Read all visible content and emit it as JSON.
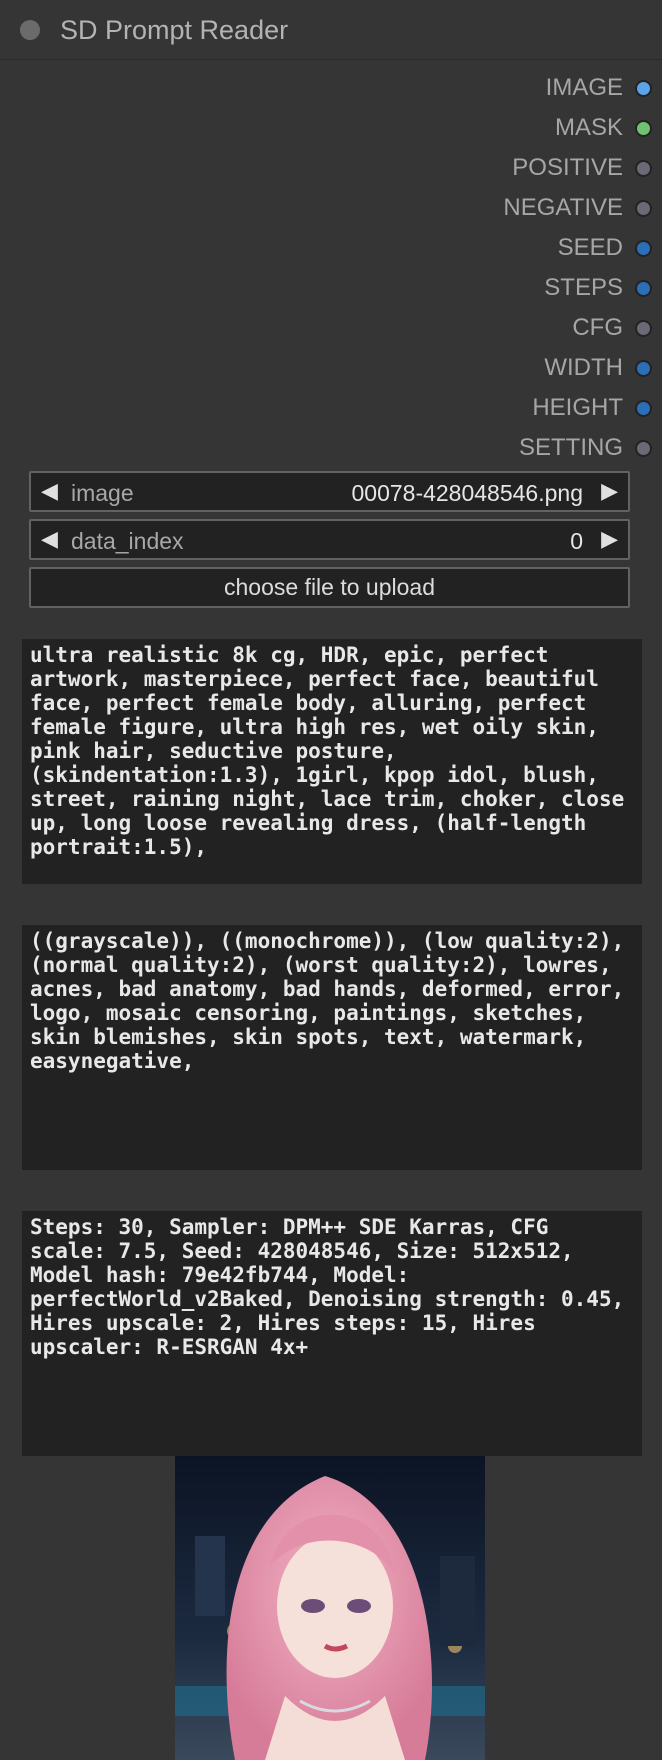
{
  "node": {
    "title": "SD Prompt Reader"
  },
  "outputs": [
    {
      "label": "IMAGE",
      "color": "#5aa3e8"
    },
    {
      "label": "MASK",
      "color": "#6fc26f"
    },
    {
      "label": "POSITIVE",
      "color": "#6a6a76"
    },
    {
      "label": "NEGATIVE",
      "color": "#6a6a76"
    },
    {
      "label": "SEED",
      "color": "#2a6fb8"
    },
    {
      "label": "STEPS",
      "color": "#2a6fb8"
    },
    {
      "label": "CFG",
      "color": "#6a6a76"
    },
    {
      "label": "WIDTH",
      "color": "#2a6fb8"
    },
    {
      "label": "HEIGHT",
      "color": "#2a6fb8"
    },
    {
      "label": "SETTING",
      "color": "#6a6a76"
    }
  ],
  "widgets": {
    "image": {
      "label": "image",
      "value": "00078-428048546.png"
    },
    "data_index": {
      "label": "data_index",
      "value": "0"
    },
    "upload": {
      "label": "choose file to upload"
    }
  },
  "texts": {
    "positive": "ultra realistic 8k cg, HDR, epic, perfect artwork, masterpiece, perfect face, beautiful face, perfect female body, alluring, perfect female figure, ultra high res, wet oily skin, pink hair, seductive posture, (skindentation:1.3), 1girl, kpop idol, blush, street, raining night, lace trim, choker, close up, long loose revealing dress, (half-length portrait:1.5),",
    "negative": "((grayscale)), ((monochrome)), (low quality:2), (normal quality:2), (worst quality:2), lowres, acnes, bad anatomy, bad hands, deformed, error, logo, mosaic censoring, paintings, sketches, skin blemishes, skin spots, text, watermark, easynegative,",
    "setting": "Steps: 30, Sampler: DPM++ SDE Karras, CFG scale: 7.5, Seed: 428048546, Size: 512x512, Model hash: 79e42fb744, Model: perfectWorld_v2Baked, Denoising strength: 0.45, Hires upscale: 2, Hires steps: 15, Hires upscaler: R-ESRGAN 4x+"
  }
}
